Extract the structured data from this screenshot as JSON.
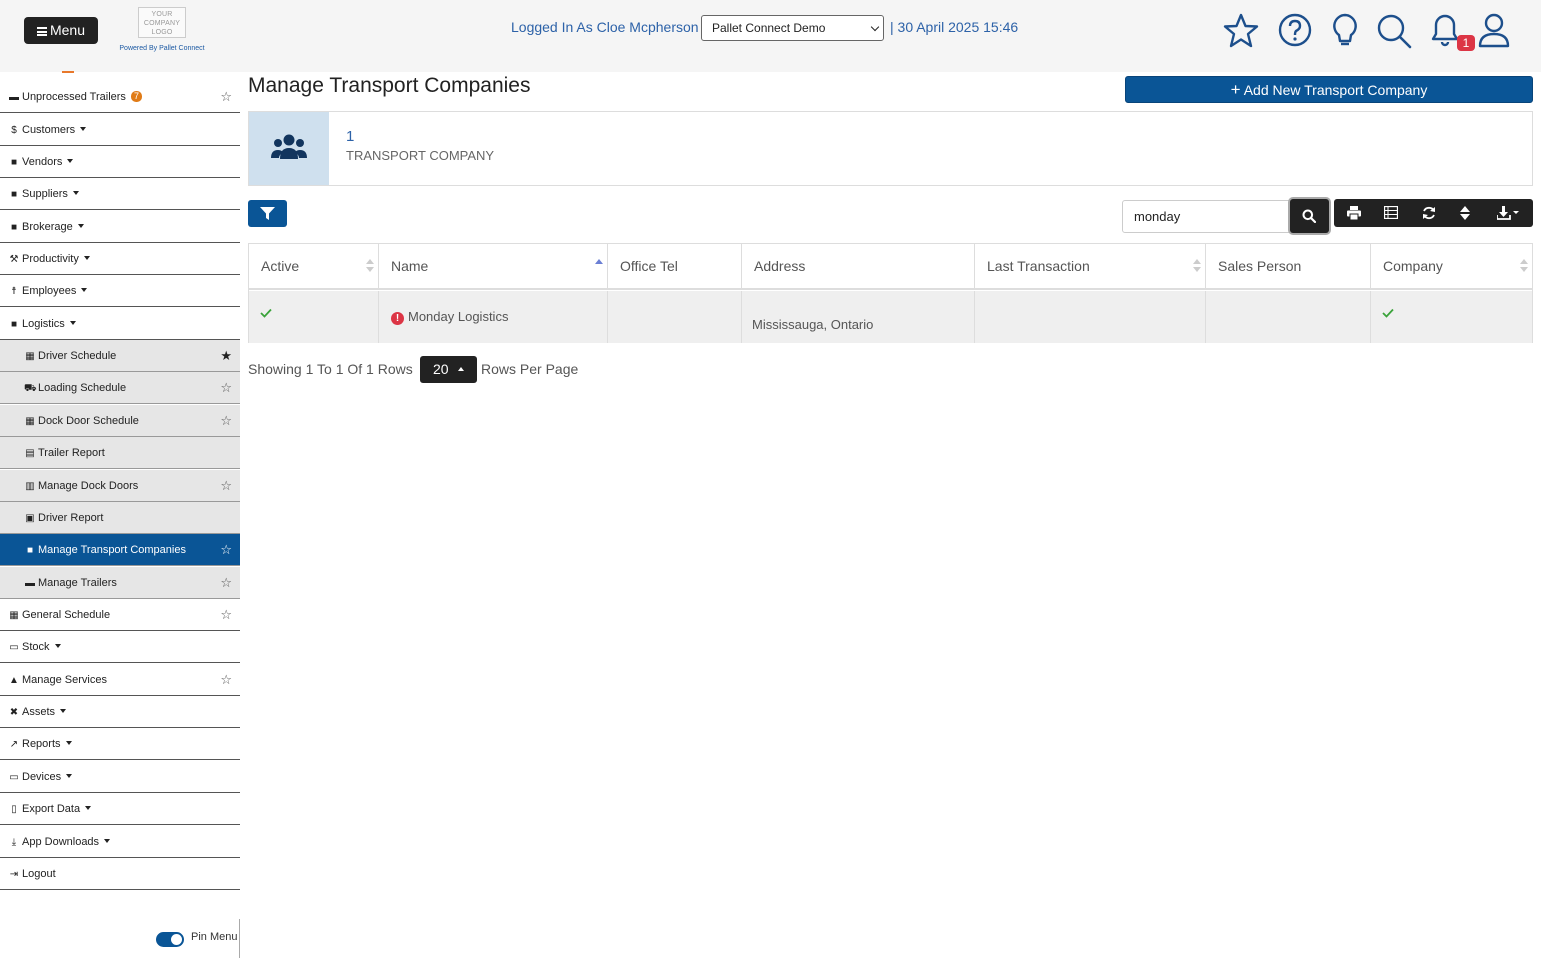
{
  "header": {
    "menu_label": "Menu",
    "logo_text": "YOUR COMPANY LOGO",
    "powered_by": "Powered By Pallet Connect",
    "logged_in": "Logged In As Cloe Mcpherson |",
    "company_selected": "Pallet Connect Demo",
    "datetime": "| 30 April 2025 15:46",
    "notification_count": "1",
    "icons": [
      "star-icon",
      "help-icon",
      "lightbulb-icon",
      "search-icon",
      "bell-icon",
      "user-icon"
    ]
  },
  "sidebar": {
    "items": [
      {
        "label": "Unprocessed Trailers",
        "badge": "7"
      },
      {
        "label": "Customers"
      },
      {
        "label": "Vendors"
      },
      {
        "label": "Suppliers"
      },
      {
        "label": "Brokerage"
      },
      {
        "label": "Productivity"
      },
      {
        "label": "Employees"
      },
      {
        "label": "Logistics"
      },
      {
        "label": "Driver Schedule"
      },
      {
        "label": "Loading Schedule"
      },
      {
        "label": "Dock Door Schedule"
      },
      {
        "label": "Trailer Report"
      },
      {
        "label": "Manage Dock Doors"
      },
      {
        "label": "Driver Report"
      },
      {
        "label": "Manage Transport Companies"
      },
      {
        "label": "Manage Trailers"
      },
      {
        "label": "General Schedule"
      },
      {
        "label": "Stock"
      },
      {
        "label": "Manage Services"
      },
      {
        "label": "Assets"
      },
      {
        "label": "Reports"
      },
      {
        "label": "Devices"
      },
      {
        "label": "Export Data"
      },
      {
        "label": "App Downloads"
      },
      {
        "label": "Logout"
      }
    ],
    "pin_label": "Pin Menu"
  },
  "main": {
    "title": "Manage Transport Companies",
    "add_button": "Add New Transport Company",
    "stat": {
      "count": "1",
      "label": "TRANSPORT COMPANY"
    },
    "search_value": "monday",
    "table": {
      "columns": [
        "Active",
        "Name",
        "Office Tel",
        "Address",
        "Last Transaction",
        "Sales Person",
        "Company"
      ],
      "rows": [
        {
          "active": true,
          "name": "Monday Logistics",
          "office_tel": "",
          "address": "Mississauga, Ontario",
          "last_transaction": "",
          "sales_person": "",
          "company": true
        }
      ]
    },
    "pager": {
      "showing": "Showing 1 To 1 Of 1 Rows",
      "per_page": "20",
      "per_page_label": "Rows Per Page"
    }
  },
  "colors": {
    "primary": "#0a5596",
    "link": "#2d62a8",
    "badge_orange": "#e07b17",
    "alert_red": "#dc3545",
    "check_green": "#3aa33a"
  }
}
